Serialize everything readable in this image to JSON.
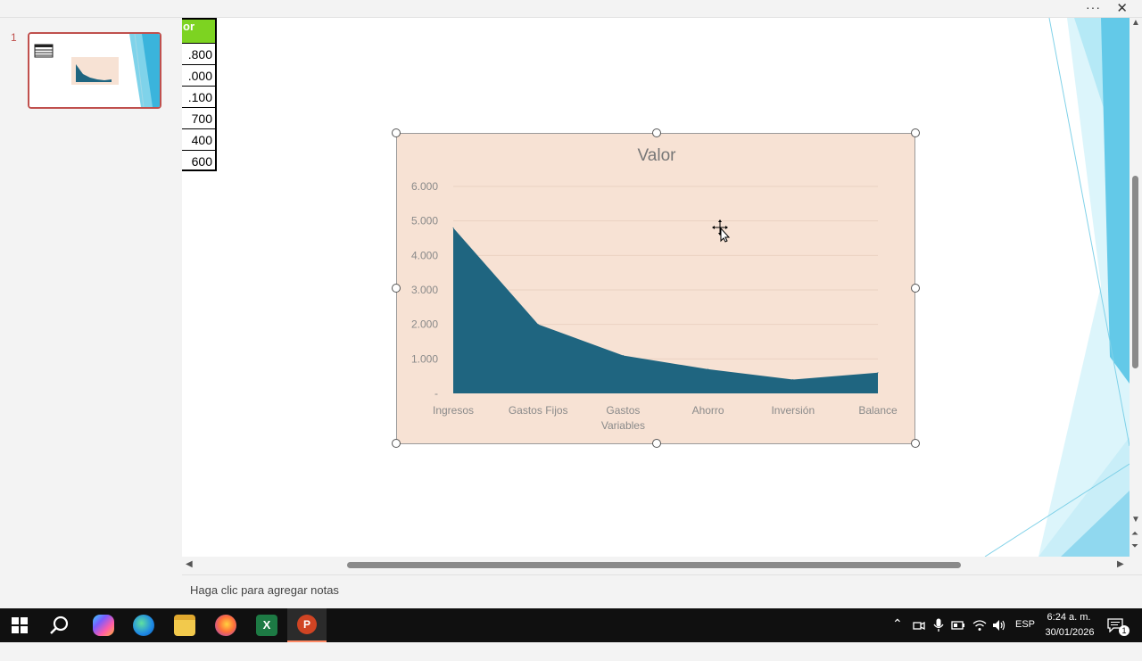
{
  "window": {
    "more_label": "···",
    "close_label": "✕"
  },
  "thumbnails": {
    "slide_number": "1"
  },
  "table_fragment": {
    "header": "or",
    "values": [
      ".800",
      ".000",
      ".100",
      "700",
      "400",
      "600"
    ]
  },
  "chart_data": {
    "type": "area",
    "title": "Valor",
    "categories": [
      "Ingresos",
      "Gastos Fijos",
      "Gastos Variables",
      "Ahorro",
      "Inversión",
      "Balance"
    ],
    "category_lines": [
      [
        "Ingresos"
      ],
      [
        "Gastos Fijos"
      ],
      [
        "Gastos",
        "Variables"
      ],
      [
        "Ahorro"
      ],
      [
        "Inversión"
      ],
      [
        "Balance"
      ]
    ],
    "values": [
      4800,
      2000,
      1100,
      700,
      400,
      600
    ],
    "ylim": [
      0,
      6000
    ],
    "yticks": [
      0,
      1000,
      2000,
      3000,
      4000,
      5000,
      6000
    ],
    "ytick_labels": [
      "-",
      "1.000",
      "2.000",
      "3.000",
      "4.000",
      "5.000",
      "6.000"
    ],
    "series_color": "#1f6580",
    "background_color": "#f7e2d4",
    "grid": true
  },
  "notes": {
    "placeholder": "Haga clic para agregar notas"
  },
  "taskbar": {
    "language": "ESP",
    "time": "6:24 a. m.",
    "date": "30/01/2026",
    "notification_count": "1"
  }
}
